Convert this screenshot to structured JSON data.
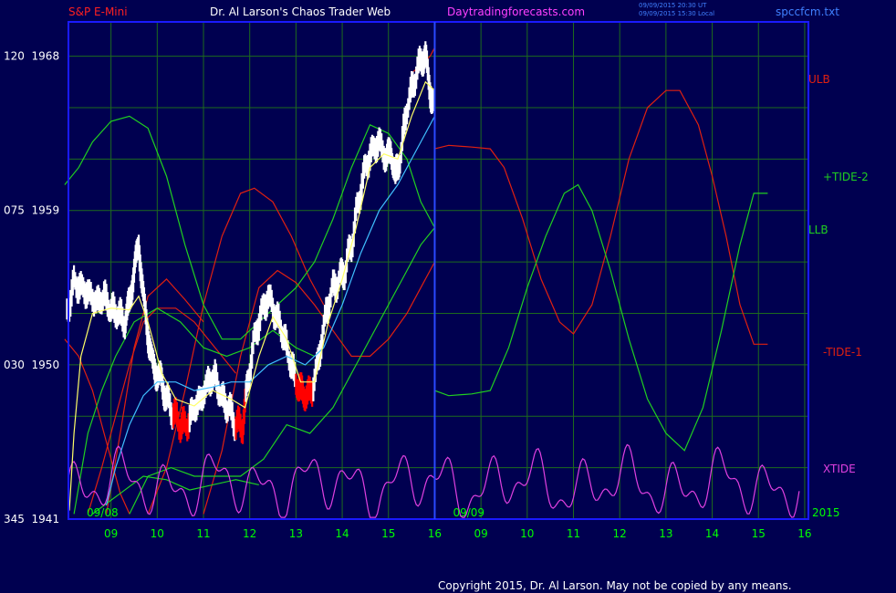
{
  "header": {
    "instrument": "S&P E-Mini",
    "title": "Dr. Al Larson's Chaos Trader Web",
    "site": "Daytradingforecasts.com",
    "time_utc": "09/09/2015 20:30 UT",
    "time_local": "09/09/2015 15:30 Local",
    "filename": "spccfcm.txt"
  },
  "copyright": "Copyright 2015, Dr. Al Larson. May not be copied by any means.",
  "colors": {
    "background": "#000050",
    "frame": "#1a1aff",
    "grid": "#1d6b1d",
    "price": "#ffffff",
    "price_down": "#ff0000",
    "ma_fast": "#ffff66",
    "ma_slow": "#40c0ff",
    "red_line": "#e02010",
    "green_line": "#20d020",
    "xtide": "#e040e0",
    "header_red": "#ff2020",
    "header_white": "#ffffff",
    "header_magenta": "#ff40ff",
    "header_blue": "#4080ff"
  },
  "chart_data": {
    "type": "line",
    "title": "Dr. Al Larson's Chaos Trader Web",
    "y_axis": {
      "range": [
        1941,
        1970
      ],
      "ticks": [
        {
          "value": 1968,
          "label": "120  1968"
        },
        {
          "value": 1959,
          "label": "075  1959"
        },
        {
          "value": 1950,
          "label": "030  1950"
        },
        {
          "value": 1941,
          "label": "345  1941"
        }
      ]
    },
    "x_axis": {
      "range": [
        8.08,
        16.08
      ],
      "ticks": [
        "09",
        "10",
        "11",
        "12",
        "13",
        "14",
        "15",
        "16",
        "09",
        "10",
        "11",
        "12",
        "13",
        "14",
        "15",
        "16"
      ],
      "date_labels": [
        "09/08",
        "09/09"
      ],
      "year_label": "2015"
    },
    "grid": true,
    "divider_at": 16.0,
    "series_labels": [
      {
        "name": "ULB",
        "color": "#e02010"
      },
      {
        "name": "+TIDE-2",
        "color": "#20d020"
      },
      {
        "name": "LLB",
        "color": "#20d020"
      },
      {
        "name": "-TIDE-1",
        "color": "#e02010"
      },
      {
        "name": "XTIDE",
        "color": "#e040e0"
      }
    ],
    "price_bars": [
      [
        8.05,
        1953.0
      ],
      [
        8.2,
        1954.8
      ],
      [
        8.35,
        1954.5
      ],
      [
        8.5,
        1954.2
      ],
      [
        8.7,
        1953.6
      ],
      [
        8.85,
        1954.0
      ],
      [
        9.0,
        1953.2
      ],
      [
        9.15,
        1953.0
      ],
      [
        9.3,
        1952.5
      ],
      [
        9.4,
        1953.6
      ],
      [
        9.5,
        1955.5
      ],
      [
        9.6,
        1957.0
      ],
      [
        9.7,
        1954.0
      ],
      [
        9.8,
        1951.8
      ],
      [
        9.9,
        1950.0
      ],
      [
        10.0,
        1949.5
      ],
      [
        10.1,
        1949.0
      ],
      [
        10.2,
        1948.0
      ],
      [
        10.35,
        1947.2
      ],
      [
        10.5,
        1946.5
      ],
      [
        10.65,
        1946.5
      ],
      [
        10.8,
        1947.5
      ],
      [
        10.95,
        1948.0
      ],
      [
        11.1,
        1949.0
      ],
      [
        11.25,
        1949.3
      ],
      [
        11.4,
        1948.0
      ],
      [
        11.55,
        1947.5
      ],
      [
        11.7,
        1946.5
      ],
      [
        11.85,
        1946.5
      ],
      [
        11.95,
        1948.8
      ],
      [
        12.1,
        1951.5
      ],
      [
        12.25,
        1953.0
      ],
      [
        12.4,
        1954.0
      ],
      [
        12.55,
        1953.0
      ],
      [
        12.7,
        1952.0
      ],
      [
        12.85,
        1950.5
      ],
      [
        13.0,
        1949.0
      ],
      [
        13.1,
        1948.5
      ],
      [
        13.2,
        1948.2
      ],
      [
        13.35,
        1948.5
      ],
      [
        13.5,
        1950.5
      ],
      [
        13.65,
        1953.0
      ],
      [
        13.8,
        1954.5
      ],
      [
        13.95,
        1955.0
      ],
      [
        14.05,
        1955.5
      ],
      [
        14.2,
        1957.0
      ],
      [
        14.35,
        1959.5
      ],
      [
        14.5,
        1961.5
      ],
      [
        14.65,
        1962.5
      ],
      [
        14.8,
        1963.0
      ],
      [
        14.95,
        1962.0
      ],
      [
        15.05,
        1962.5
      ],
      [
        15.15,
        1961.0
      ],
      [
        15.25,
        1962.0
      ],
      [
        15.4,
        1965.0
      ],
      [
        15.55,
        1966.5
      ],
      [
        15.7,
        1967.8
      ],
      [
        15.8,
        1968.0
      ],
      [
        15.9,
        1966.0
      ],
      [
        16.0,
        1965.0
      ]
    ],
    "red_down_segments": [
      [
        10.35,
        10.7
      ],
      [
        11.7,
        11.9
      ],
      [
        13.0,
        13.35
      ]
    ],
    "ma_fast": [
      [
        8.1,
        1941.5
      ],
      [
        8.2,
        1946.0
      ],
      [
        8.35,
        1950.5
      ],
      [
        8.6,
        1953.0
      ],
      [
        9.0,
        1953.3
      ],
      [
        9.4,
        1953.2
      ],
      [
        9.6,
        1954.0
      ],
      [
        9.8,
        1952.5
      ],
      [
        10.1,
        1949.5
      ],
      [
        10.4,
        1948.0
      ],
      [
        10.8,
        1947.6
      ],
      [
        11.2,
        1948.5
      ],
      [
        11.6,
        1948.0
      ],
      [
        11.9,
        1947.5
      ],
      [
        12.2,
        1950.5
      ],
      [
        12.5,
        1952.8
      ],
      [
        12.8,
        1951.5
      ],
      [
        13.1,
        1949.0
      ],
      [
        13.4,
        1949.0
      ],
      [
        13.7,
        1952.5
      ],
      [
        14.0,
        1955.0
      ],
      [
        14.3,
        1958.0
      ],
      [
        14.6,
        1961.5
      ],
      [
        14.9,
        1962.3
      ],
      [
        15.2,
        1962.0
      ],
      [
        15.5,
        1964.5
      ],
      [
        15.8,
        1966.5
      ],
      [
        16.0,
        1966.0
      ]
    ],
    "ma_slow": [
      [
        8.9,
        1941.8
      ],
      [
        9.1,
        1944.0
      ],
      [
        9.4,
        1946.5
      ],
      [
        9.7,
        1948.2
      ],
      [
        10.0,
        1949.0
      ],
      [
        10.4,
        1949.0
      ],
      [
        10.8,
        1948.5
      ],
      [
        11.2,
        1948.7
      ],
      [
        11.6,
        1949.0
      ],
      [
        12.0,
        1949.0
      ],
      [
        12.4,
        1950.0
      ],
      [
        12.8,
        1950.5
      ],
      [
        13.2,
        1950.0
      ],
      [
        13.6,
        1951.0
      ],
      [
        14.0,
        1953.5
      ],
      [
        14.4,
        1956.5
      ],
      [
        14.8,
        1959.0
      ],
      [
        15.2,
        1960.5
      ],
      [
        15.6,
        1962.5
      ],
      [
        16.0,
        1964.5
      ]
    ],
    "red_lines": [
      [
        [
          8.0,
          1951.5
        ],
        [
          8.3,
          1950.5
        ],
        [
          8.6,
          1948.5
        ],
        [
          8.9,
          1945.5
        ],
        [
          9.2,
          1942.5
        ],
        [
          9.4,
          1941.3
        ]
      ],
      [
        [
          8.5,
          1941.3
        ],
        [
          8.8,
          1944.0
        ],
        [
          9.1,
          1947.0
        ],
        [
          9.4,
          1950.0
        ],
        [
          9.7,
          1952.5
        ],
        [
          10.0,
          1953.3
        ],
        [
          10.4,
          1953.3
        ],
        [
          10.8,
          1952.5
        ],
        [
          11.1,
          1951.5
        ],
        [
          11.4,
          1950.5
        ],
        [
          11.7,
          1949.5
        ]
      ],
      [
        [
          8.9,
          1941.3
        ],
        [
          9.2,
          1946.0
        ],
        [
          9.5,
          1951.0
        ],
        [
          9.8,
          1954.0
        ],
        [
          10.2,
          1955.0
        ],
        [
          10.6,
          1953.8
        ],
        [
          11.0,
          1952.5
        ]
      ],
      [
        [
          9.8,
          1941.3
        ],
        [
          10.2,
          1944.0
        ],
        [
          10.6,
          1948.5
        ],
        [
          11.0,
          1953.5
        ],
        [
          11.4,
          1957.5
        ],
        [
          11.8,
          1960.0
        ],
        [
          12.1,
          1960.3
        ],
        [
          12.5,
          1959.5
        ],
        [
          12.9,
          1957.5
        ],
        [
          13.3,
          1955.0
        ],
        [
          13.6,
          1953.5
        ]
      ],
      [
        [
          11.0,
          1941.3
        ],
        [
          11.4,
          1945.0
        ],
        [
          11.8,
          1950.5
        ],
        [
          12.2,
          1954.5
        ],
        [
          12.6,
          1955.5
        ],
        [
          13.0,
          1954.8
        ],
        [
          13.4,
          1953.5
        ],
        [
          13.8,
          1952.0
        ],
        [
          14.2,
          1950.5
        ],
        [
          14.6,
          1950.5
        ],
        [
          15.0,
          1951.5
        ],
        [
          15.4,
          1953.0
        ],
        [
          15.7,
          1954.5
        ],
        [
          16.0,
          1956.0
        ]
      ],
      [
        [
          15.5,
          1967.0
        ],
        [
          15.7,
          1967.5
        ],
        [
          15.9,
          1968.0
        ],
        [
          16.0,
          1968.5
        ]
      ],
      [
        [
          16.0,
          1962.6
        ],
        [
          16.3,
          1962.8
        ],
        [
          16.8,
          1962.7
        ],
        [
          17.2,
          1962.6
        ],
        [
          17.5,
          1961.5
        ],
        [
          17.9,
          1958.5
        ],
        [
          18.3,
          1955.0
        ],
        [
          18.7,
          1952.5
        ],
        [
          19.0,
          1951.8
        ],
        [
          19.4,
          1953.5
        ],
        [
          19.8,
          1957.5
        ],
        [
          20.2,
          1962.0
        ],
        [
          20.6,
          1965.0
        ],
        [
          21.0,
          1966.0
        ],
        [
          21.3,
          1966.0
        ],
        [
          21.7,
          1964.0
        ],
        [
          22.0,
          1961.0
        ],
        [
          22.3,
          1957.5
        ],
        [
          22.6,
          1953.5
        ],
        [
          22.9,
          1951.2
        ],
        [
          23.2,
          1951.2
        ]
      ]
    ],
    "green_lines": [
      [
        [
          8.0,
          1960.5
        ],
        [
          8.3,
          1961.5
        ],
        [
          8.6,
          1963.0
        ],
        [
          9.0,
          1964.2
        ],
        [
          9.4,
          1964.5
        ],
        [
          9.8,
          1963.8
        ],
        [
          10.2,
          1961.0
        ],
        [
          10.6,
          1957.0
        ],
        [
          11.0,
          1953.5
        ],
        [
          11.4,
          1951.5
        ],
        [
          11.8,
          1951.5
        ],
        [
          12.2,
          1952.5
        ],
        [
          12.6,
          1953.5
        ],
        [
          13.0,
          1954.5
        ],
        [
          13.4,
          1956.0
        ],
        [
          13.8,
          1958.5
        ],
        [
          14.2,
          1961.5
        ],
        [
          14.6,
          1964.0
        ],
        [
          15.0,
          1963.5
        ],
        [
          15.4,
          1962.0
        ],
        [
          15.7,
          1959.5
        ],
        [
          16.0,
          1958.0
        ]
      ],
      [
        [
          8.2,
          1941.3
        ],
        [
          8.5,
          1946.0
        ],
        [
          8.8,
          1948.5
        ],
        [
          9.1,
          1950.5
        ],
        [
          9.5,
          1952.5
        ],
        [
          10.0,
          1953.3
        ],
        [
          10.5,
          1952.5
        ],
        [
          11.0,
          1951.0
        ],
        [
          11.5,
          1950.5
        ],
        [
          12.0,
          1951.0
        ],
        [
          12.5,
          1952.0
        ],
        [
          13.0,
          1951.0
        ],
        [
          13.4,
          1950.5
        ]
      ],
      [
        [
          9.4,
          1941.3
        ],
        [
          9.8,
          1943.5
        ],
        [
          10.3,
          1944.0
        ],
        [
          10.8,
          1943.5
        ],
        [
          11.3,
          1943.5
        ],
        [
          11.8,
          1943.5
        ],
        [
          12.3,
          1944.5
        ],
        [
          12.8,
          1946.5
        ],
        [
          13.3,
          1946.0
        ],
        [
          13.8,
          1947.5
        ],
        [
          14.3,
          1950.0
        ],
        [
          14.8,
          1952.5
        ],
        [
          15.3,
          1955.0
        ],
        [
          15.7,
          1957.0
        ],
        [
          16.0,
          1958.0
        ]
      ],
      [
        [
          8.6,
          1941.3
        ],
        [
          9.2,
          1942.5
        ],
        [
          9.7,
          1943.5
        ],
        [
          10.2,
          1943.3
        ],
        [
          10.7,
          1942.7
        ],
        [
          11.2,
          1943.0
        ],
        [
          11.7,
          1943.3
        ],
        [
          12.2,
          1943.0
        ]
      ],
      [
        [
          16.0,
          1964.0
        ],
        [
          16.0,
          1948.5
        ],
        [
          16.3,
          1948.2
        ],
        [
          16.8,
          1948.3
        ],
        [
          17.2,
          1948.5
        ],
        [
          17.6,
          1951.0
        ],
        [
          18.0,
          1954.5
        ],
        [
          18.4,
          1957.5
        ],
        [
          18.8,
          1960.0
        ],
        [
          19.1,
          1960.5
        ],
        [
          19.4,
          1959.0
        ],
        [
          19.8,
          1955.5
        ],
        [
          20.2,
          1951.5
        ],
        [
          20.6,
          1948.0
        ],
        [
          21.0,
          1946.0
        ],
        [
          21.4,
          1945.0
        ],
        [
          21.8,
          1947.5
        ],
        [
          22.2,
          1952.0
        ],
        [
          22.6,
          1957.0
        ],
        [
          22.9,
          1960.0
        ],
        [
          23.2,
          1960.0
        ]
      ]
    ]
  }
}
